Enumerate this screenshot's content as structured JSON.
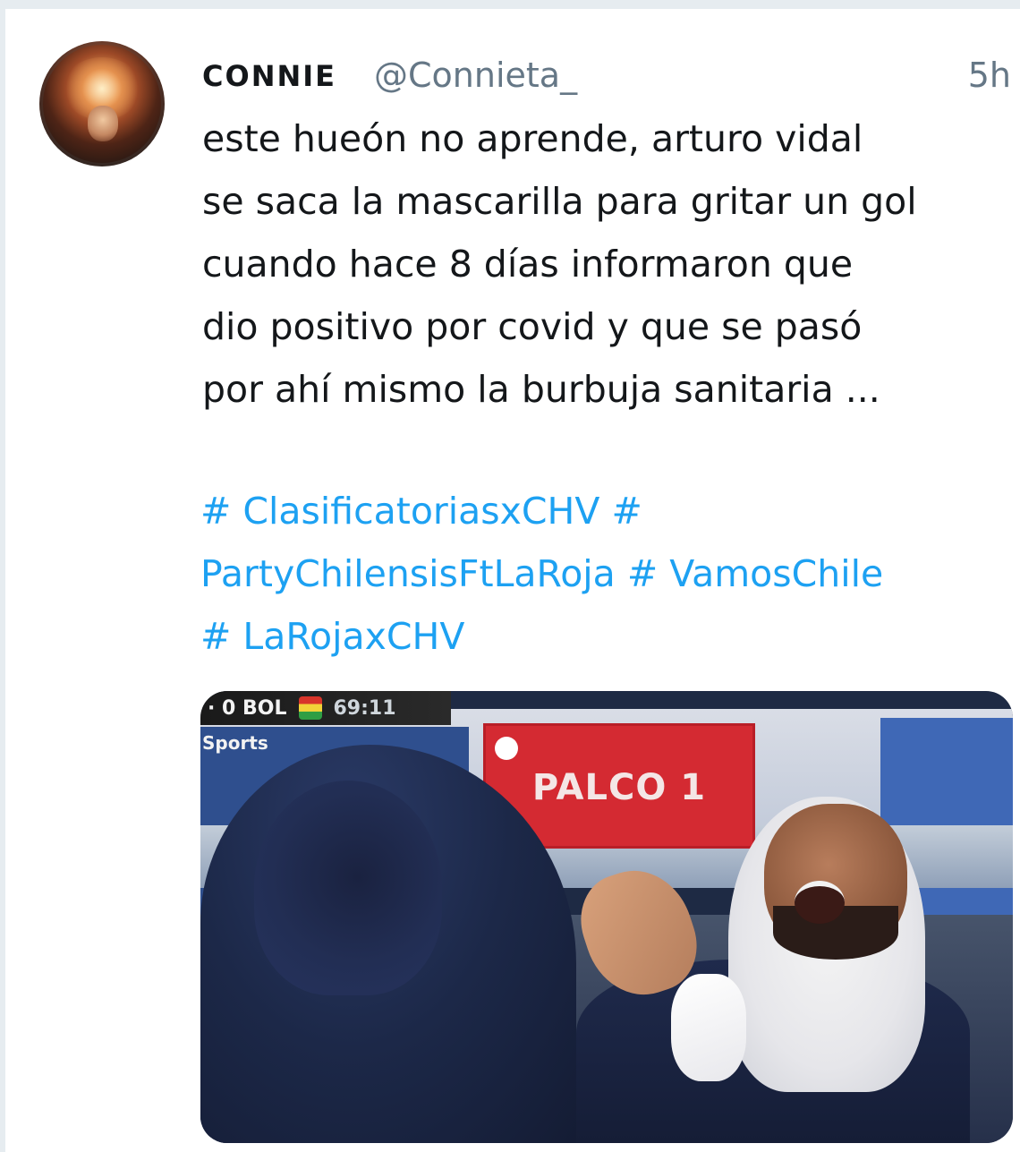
{
  "tweet": {
    "display_name": "CONNIE",
    "handle": "@Connieta_",
    "timestamp": "5h",
    "text_lines": [
      "este hueón no aprende, arturo vidal",
      "se saca la mascarilla para gritar un gol",
      "cuando hace 8 días informaron que",
      "dio positivo por covid y que se pasó",
      "por ahí mismo la burbuja sanitaria ..."
    ],
    "hashtag_lines": [
      [
        " # ClasificatoriasxCHV",
        "  #"
      ],
      [
        "PartyChilensisFtLaRoja",
        "  # VamosChile"
      ],
      [
        "# LaRojaxCHV"
      ]
    ]
  },
  "media": {
    "score": "· 0 BOL",
    "clock": "69:11",
    "broadcaster": "Sports",
    "sign_text": "PALCO 1"
  },
  "colors": {
    "link": "#1da1f2",
    "secondary_text": "#657786",
    "primary_text": "#14171a",
    "border": "#e6ecf0"
  }
}
